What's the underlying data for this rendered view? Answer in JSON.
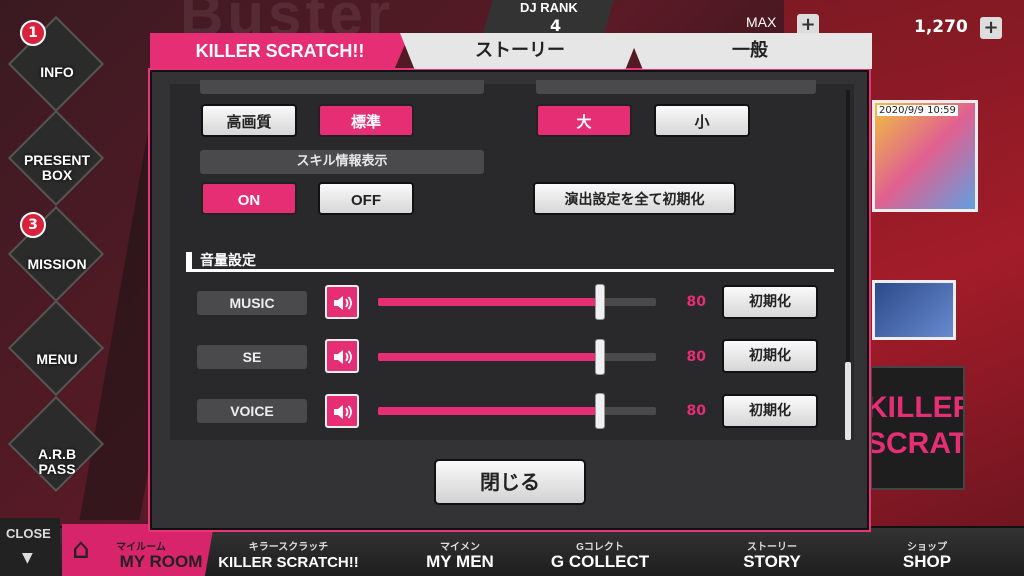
{
  "background": {
    "side_menu": [
      {
        "label": "INFO",
        "badge": "1"
      },
      {
        "label": "PRESENT\nBOX",
        "badge": ""
      },
      {
        "label": "MISSION",
        "badge": "3"
      },
      {
        "label": "MENU",
        "badge": ""
      },
      {
        "label": "A.R.B\nPASS",
        "badge": ""
      }
    ],
    "dj_rank_label": "DJ RANK",
    "dj_rank_value": "4",
    "max_label": "MAX",
    "coin_value": "1,270",
    "thumb_date": "2020/9/9 10:59",
    "banner_text": "KILLER SCRATCH!!",
    "bottom_nav": {
      "close_label": "CLOSE",
      "items": [
        {
          "sub": "マイルーム",
          "label": "MY ROOM"
        },
        {
          "sub": "キラースクラッチ",
          "label": "KILLER SCRATCH!!"
        },
        {
          "sub": "マイメン",
          "label": "MY MEN"
        },
        {
          "sub": "Gコレクト",
          "label": "G COLLECT"
        },
        {
          "sub": "ストーリー",
          "label": "STORY"
        },
        {
          "sub": "ショップ",
          "label": "SHOP"
        }
      ]
    }
  },
  "modal": {
    "tabs": [
      {
        "label": "KILLER SCRATCH!!",
        "active": true
      },
      {
        "label": "ストーリー",
        "active": false
      },
      {
        "label": "一般",
        "active": false
      }
    ],
    "quality": {
      "options": [
        "高画質",
        "標準"
      ],
      "selected": "標準"
    },
    "size": {
      "options": [
        "大",
        "小"
      ],
      "selected": "大"
    },
    "skill_info": {
      "header": "スキル情報表示",
      "options": [
        "ON",
        "OFF"
      ],
      "selected": "ON"
    },
    "reset_effects_label": "演出設定を全て初期化",
    "volume_section_title": "音量設定",
    "volumes": [
      {
        "label": "MUSIC",
        "value": 80,
        "value_text": "80",
        "reset_label": "初期化"
      },
      {
        "label": "SE",
        "value": 80,
        "value_text": "80",
        "reset_label": "初期化"
      },
      {
        "label": "VOICE",
        "value": 80,
        "value_text": "80",
        "reset_label": "初期化"
      }
    ],
    "close_label": "閉じる"
  },
  "colors": {
    "accent": "#e62e75",
    "panel": "#333235",
    "inner": "#29282b",
    "label_bg": "#4a4a4c"
  }
}
